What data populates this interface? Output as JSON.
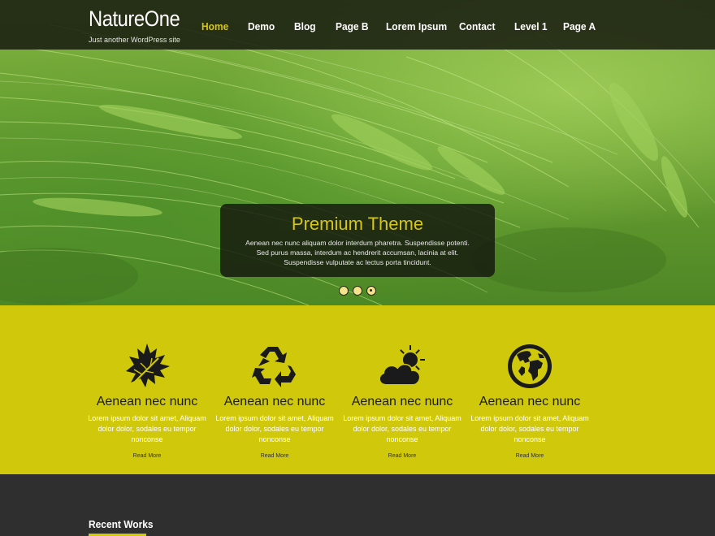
{
  "site": {
    "title": "NatureOne",
    "tagline": "Just another WordPress site"
  },
  "nav": {
    "items": [
      {
        "label": "Home",
        "active": true
      },
      {
        "label": "Demo",
        "active": false
      },
      {
        "label": "Blog",
        "active": false
      },
      {
        "label": "Page B",
        "active": false
      },
      {
        "label": "Lorem Ipsum",
        "active": false
      },
      {
        "label": "Contact",
        "active": false
      },
      {
        "label": "Level 1",
        "active": false
      },
      {
        "label": "Page A",
        "active": false
      }
    ]
  },
  "slider": {
    "title": "Premium Theme",
    "text": "Aenean nec nunc aliquam dolor interdum pharetra. Suspendisse potenti. Sed purus massa, interdum ac hendrerit accumsan, lacinia at elit. Suspendisse vulputate ac lectus porta tincidunt.",
    "slide_count": 3,
    "active_slide": 3
  },
  "features": [
    {
      "icon": "leaf-icon",
      "title": "Aenean nec nunc",
      "text": "Lorem ipsum dolor sit amet, Aliquam dolor dolor, sodales eu tempor nonconse",
      "link": "Read More"
    },
    {
      "icon": "recycle-icon",
      "title": "Aenean nec nunc",
      "text": "Lorem ipsum dolor sit amet, Aliquam dolor dolor, sodales eu tempor nonconse",
      "link": "Read More"
    },
    {
      "icon": "weather-icon",
      "title": "Aenean nec nunc",
      "text": "Lorem ipsum dolor sit amet, Aliquam dolor dolor, sodales eu tempor nonconse",
      "link": "Read More"
    },
    {
      "icon": "globe-icon",
      "title": "Aenean nec nunc",
      "text": "Lorem ipsum dolor sit amet, Aliquam dolor dolor, sodales eu tempor nonconse",
      "link": "Read More"
    }
  ],
  "recent": {
    "title": "Recent Works"
  },
  "colors": {
    "accent": "#d6c617",
    "features_bg": "#d0c80b",
    "header_bg": "#15170f",
    "footer_bg": "#2f2f2f",
    "hero_green": "#6fa535"
  }
}
